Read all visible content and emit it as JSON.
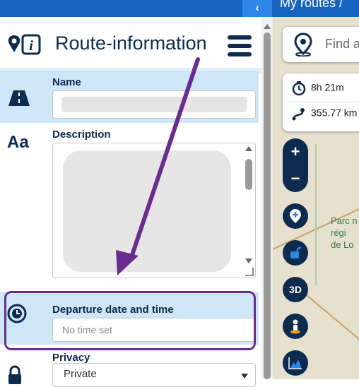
{
  "header": {
    "title": "Route-information",
    "top_title": "My routes",
    "top_separator": "/"
  },
  "fields": {
    "name_label": "Name",
    "description_label": "Description",
    "departure_label": "Departure date and time",
    "departure_placeholder": "No time set",
    "privacy_label": "Privacy",
    "privacy_value": "Private"
  },
  "map": {
    "search_placeholder": "Find a",
    "duration": "8h 21m",
    "distance": "355.77 km",
    "zoom_in": "+",
    "zoom_out": "−",
    "btn_3d": "3D",
    "place_label_lines": [
      "Parc n",
      "régi",
      "de Lo"
    ]
  },
  "colors": {
    "brand_navy": "#0d2a4f",
    "topbar_blue": "#1565c0",
    "row_highlight": "#cfe6f8",
    "annotation_purple": "#6a2c8e"
  }
}
